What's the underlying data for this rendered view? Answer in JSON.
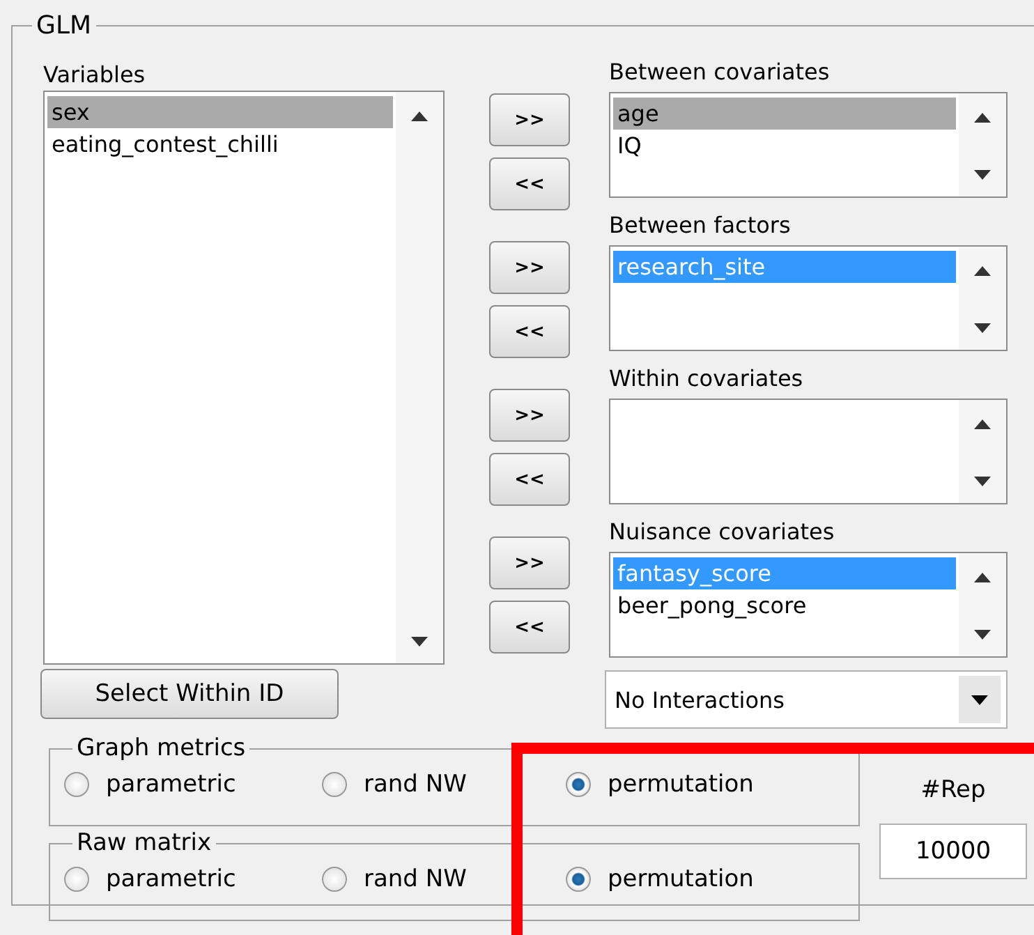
{
  "panel_title": "GLM",
  "variables": {
    "label": "Variables",
    "focused": false,
    "items": [
      {
        "text": "sex",
        "selected": true
      },
      {
        "text": "eating_contest_chilli",
        "selected": false
      }
    ]
  },
  "select_within_id_button": "Select Within ID",
  "transfer_buttons": [
    {
      "add": ">>",
      "remove": "<<"
    },
    {
      "add": ">>",
      "remove": "<<"
    },
    {
      "add": ">>",
      "remove": "<<"
    },
    {
      "add": ">>",
      "remove": "<<"
    }
  ],
  "lists": [
    {
      "label": "Between covariates",
      "focused": false,
      "items": [
        {
          "text": "age",
          "selected": true
        },
        {
          "text": "IQ",
          "selected": false
        }
      ]
    },
    {
      "label": "Between factors",
      "focused": true,
      "items": [
        {
          "text": "research_site",
          "selected": true
        }
      ]
    },
    {
      "label": "Within covariates"
    },
    {
      "label": "Nuisance covariates",
      "focused": true,
      "items": [
        {
          "text": "fantasy_score",
          "selected": true
        },
        {
          "text": "beer_pong_score",
          "selected": false
        }
      ]
    }
  ],
  "interaction_dropdown": {
    "value": "No Interactions"
  },
  "radio_groups": [
    {
      "label": "Graph metrics",
      "options": [
        {
          "label": "parametric",
          "selected": false
        },
        {
          "label": "rand NW",
          "selected": false
        },
        {
          "label": "permutation",
          "selected": true
        }
      ]
    },
    {
      "label": "Raw matrix",
      "options": [
        {
          "label": "parametric",
          "selected": false
        },
        {
          "label": "rand NW",
          "selected": false
        },
        {
          "label": "permutation",
          "selected": true
        }
      ]
    }
  ],
  "repetitions": {
    "label": "#Rep",
    "value": "10000"
  }
}
